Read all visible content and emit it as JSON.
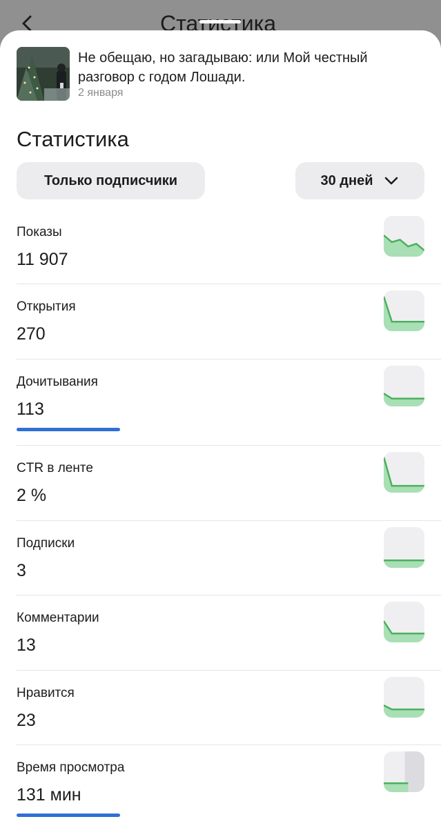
{
  "header": {
    "title": "Статистика"
  },
  "article": {
    "title": "Не обещаю, но загадываю: или Мой честный разговор с годом Лошади.",
    "date": "2 января"
  },
  "stats": {
    "title": "Статистика",
    "filter_audience": "Только подписчики",
    "filter_period": "30 дней"
  },
  "metrics": [
    {
      "label": "Показы",
      "value": "11 907",
      "trend": [
        0.55,
        0.35,
        0.42,
        0.22,
        0.3,
        0.1
      ]
    },
    {
      "label": "Открытия",
      "value": "270",
      "trend": [
        0.95,
        0.2,
        0.2,
        0.2,
        0.2,
        0.2
      ]
    },
    {
      "label": "Дочитывания",
      "value": "113",
      "trend": [
        0.3,
        0.15,
        0.15,
        0.15,
        0.15,
        0.15
      ],
      "progress": 0.44
    },
    {
      "label": "CTR в ленте",
      "value": "2 %",
      "trend": [
        0.98,
        0.12,
        0.12,
        0.12,
        0.12,
        0.12
      ]
    },
    {
      "label": "Подписки",
      "value": "3",
      "trend": [
        0.14,
        0.14,
        0.14,
        0.14,
        0.14,
        0.14
      ]
    },
    {
      "label": "Комментарии",
      "value": "13",
      "trend": [
        0.55,
        0.18,
        0.18,
        0.18,
        0.18,
        0.18
      ]
    },
    {
      "label": "Нравится",
      "value": "23",
      "trend": [
        0.28,
        0.16,
        0.16,
        0.16,
        0.16,
        0.16
      ]
    },
    {
      "label": "Время просмотра",
      "value": "131 мин",
      "trend": [
        0.18,
        0.18,
        0.18,
        0.18,
        0.0,
        0.0
      ],
      "progress": 0.44
    }
  ],
  "colors": {
    "accent_blue": "#2f6fd6",
    "spark_line": "#4caf5f",
    "spark_fill": "#a8dfb4",
    "chip_bg": "#ececee"
  }
}
